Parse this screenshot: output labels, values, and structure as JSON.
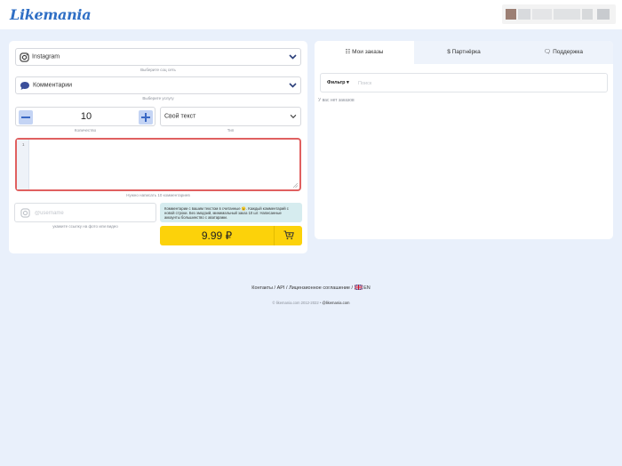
{
  "brand": {
    "logo_text": "Likemania",
    "color": "#2f6fc5"
  },
  "order_form": {
    "network": {
      "value": "Instagram",
      "hint": "Выберите соц сеть"
    },
    "service": {
      "value": "Комментарии",
      "hint": "Выберите услугу"
    },
    "quantity": {
      "value": "10",
      "hint": "Количество"
    },
    "type": {
      "value": "Свой текст",
      "hint": "Тип"
    },
    "comments": {
      "line_number": "1",
      "hint": "Нужно написать 10 комментариев"
    },
    "link": {
      "placeholder": "@username",
      "hint": "укажите ссылку на фото или видео"
    },
    "info_text": "Комментарии с вашим текстом в считанные 😉. Каждый комментарий с новой строки. Без эмодзий, минимальный заказ 10 шт. Написанные аккаунты большинство с аватарами.",
    "price": "9.99 ₽",
    "accent_color": "#fcd20a",
    "error_color": "#e06060"
  },
  "tabs": [
    {
      "icon": "list-icon",
      "label": "Мои заказы"
    },
    {
      "icon": "dollar-icon",
      "label": "Партнёрка"
    },
    {
      "icon": "chat-icon",
      "label": "Поддержка"
    }
  ],
  "orders": {
    "filter_label": "Фильтр",
    "search_placeholder": "Поиск",
    "empty_text": "У вас нет заказов"
  },
  "footer": {
    "links": [
      "Контакты",
      "API",
      "Лицензионное соглашение"
    ],
    "separator": "/",
    "language": "EN",
    "copyright": "© likemania.com 2012-2022 •",
    "copyright_handle": "@likemania.com"
  }
}
